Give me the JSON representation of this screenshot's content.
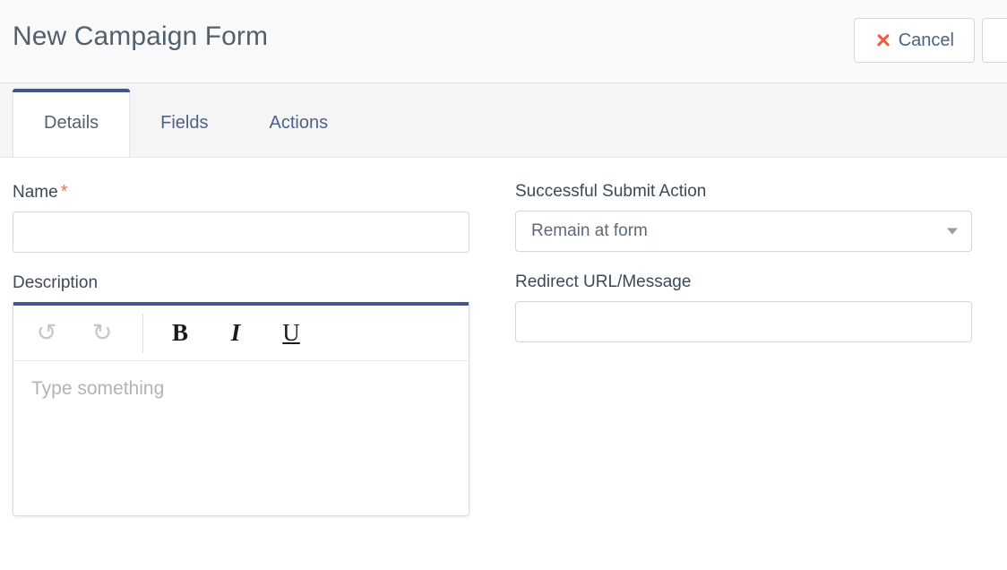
{
  "header": {
    "title": "New Campaign Form",
    "cancel_label": "Cancel",
    "cancel_icon": "close-x-icon"
  },
  "tabs": [
    {
      "label": "Details",
      "active": true
    },
    {
      "label": "Fields",
      "active": false
    },
    {
      "label": "Actions",
      "active": false
    }
  ],
  "form": {
    "name": {
      "label": "Name",
      "required_marker": "*",
      "value": "",
      "placeholder": ""
    },
    "description": {
      "label": "Description",
      "placeholder": "Type something",
      "value": "",
      "toolbar": {
        "undo": "↺",
        "redo": "↻",
        "bold": "B",
        "italic": "I",
        "underline": "U"
      }
    },
    "submit_action": {
      "label": "Successful Submit Action",
      "value": "Remain at form",
      "caret_icon": "chevron-down-icon"
    },
    "redirect": {
      "label": "Redirect URL/Message",
      "value": "",
      "placeholder": ""
    }
  },
  "colors": {
    "accent_navy": "#43548f",
    "link_blue": "#4c6287",
    "title_gray": "#51606e",
    "required_red": "#f0705a",
    "cancel_icon_red": "#f05a41"
  }
}
